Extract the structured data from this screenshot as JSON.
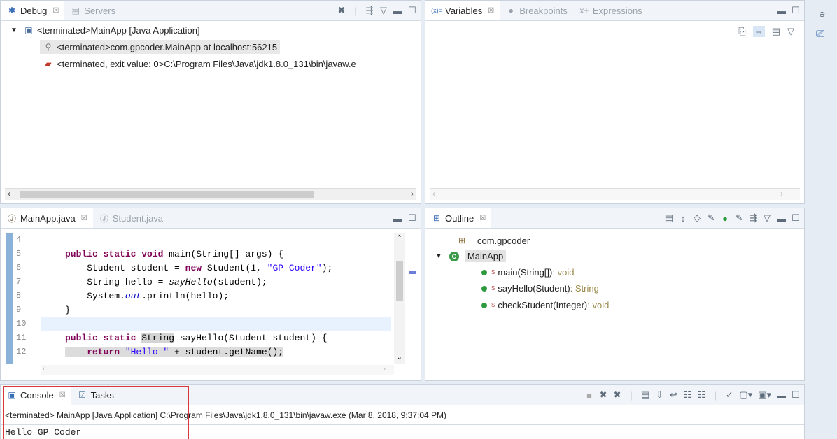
{
  "debug": {
    "tabs": [
      {
        "label": "Debug",
        "active": true
      },
      {
        "label": "Servers",
        "active": false
      }
    ],
    "rows": [
      {
        "text": "<terminated>MainApp [Java Application]"
      },
      {
        "text": "<terminated>com.gpcoder.MainApp at localhost:56215"
      },
      {
        "text": "<terminated, exit value: 0>C:\\Program Files\\Java\\jdk1.8.0_131\\bin\\javaw.e"
      }
    ]
  },
  "variables": {
    "tabs": [
      {
        "label": "Variables"
      },
      {
        "label": "Breakpoints"
      },
      {
        "label": "Expressions"
      }
    ]
  },
  "editor": {
    "tabs": [
      {
        "label": "MainApp.java"
      },
      {
        "label": "Student.java"
      }
    ],
    "lines": [
      {
        "num": "4"
      },
      {
        "num": "5"
      },
      {
        "num": "6"
      },
      {
        "num": "7"
      },
      {
        "num": "8"
      },
      {
        "num": "9"
      },
      {
        "num": "10"
      },
      {
        "num": "11"
      },
      {
        "num": "12"
      }
    ],
    "code": {
      "l5_kw": "public static void ",
      "l5_rest": "main(String[] args) {",
      "l6_a": "    Student student = ",
      "l6_kw": "new",
      "l6_b": " Student(1, ",
      "l6_str": "\"GP Coder\"",
      "l6_c": ");",
      "l7_a": "    String hello = ",
      "l7_it": "sayHello",
      "l7_b": "(student);",
      "l8_a": "    System.",
      "l8_fld": "out",
      "l8_b": ".println(hello);",
      "l9": "}",
      "l11_kw": "public static ",
      "l11_type": "String",
      "l11_rest": " sayHello(Student student) {",
      "l12_kw": "    return ",
      "l12_str": "\"Hello \"",
      "l12_rest": " + student.getName();"
    }
  },
  "outline": {
    "tab": "Outline",
    "package": "com.gpcoder",
    "class": "MainApp",
    "methods": [
      {
        "name": "main(String[])",
        "ret": " : void"
      },
      {
        "name": "sayHello(Student)",
        "ret": " : String"
      },
      {
        "name": "checkStudent(Integer)",
        "ret": " : void"
      }
    ]
  },
  "console": {
    "tabs": [
      {
        "label": "Console"
      },
      {
        "label": "Tasks"
      }
    ],
    "header": "<terminated> MainApp [Java Application] C:\\Program Files\\Java\\jdk1.8.0_131\\bin\\javaw.exe (Mar 8, 2018, 9:37:04 PM)",
    "output": "Hello GP Coder"
  },
  "colors": {
    "highlight_box": "#d9363e",
    "code_keyword": "#7f0055",
    "code_string": "#2a00ff"
  }
}
